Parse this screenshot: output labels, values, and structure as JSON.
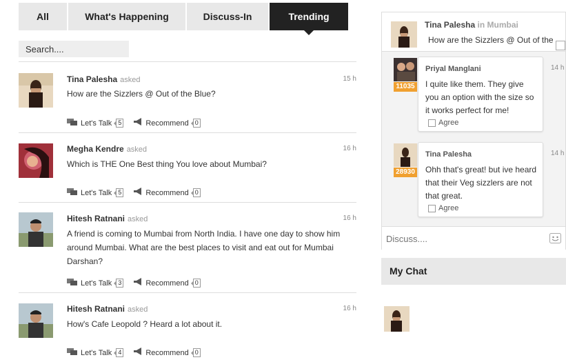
{
  "tabs": [
    {
      "label": "All",
      "active": false
    },
    {
      "label": "What's Happening",
      "active": false
    },
    {
      "label": "Discuss-In",
      "active": false
    },
    {
      "label": "Trending",
      "active": true
    }
  ],
  "search": {
    "placeholder": "Search...."
  },
  "feed": [
    {
      "name": "Tina Palesha",
      "asked": "asked",
      "time": "15 h",
      "question": "How are the Sizzlers @ Out of the Blue?",
      "talk_label": "Let's Talk",
      "talk_count": "5",
      "recommend_label": "Recommend",
      "recommend_count": "0"
    },
    {
      "name": "Megha Kendre",
      "asked": "asked",
      "time": "16 h",
      "question": "Which is THE One Best thing You love about Mumbai?",
      "talk_label": "Let's Talk",
      "talk_count": "5",
      "recommend_label": "Recommend",
      "recommend_count": "0"
    },
    {
      "name": "Hitesh Ratnani",
      "asked": "asked",
      "time": "16 h",
      "question": "A friend is coming to Mumbai from North India. I have one day to show him around Mumbai. What are the best places to visit and eat out for Mumbai Darshan?",
      "talk_label": "Let's Talk",
      "talk_count": "3",
      "recommend_label": "Recommend",
      "recommend_count": "0"
    },
    {
      "name": "Hitesh Ratnani",
      "asked": "asked",
      "time": "16 h",
      "question": "How's Cafe Leopold ? Heard a lot about it.",
      "talk_label": "Let's Talk",
      "talk_count": "4",
      "recommend_label": "Recommend",
      "recommend_count": "0"
    }
  ],
  "panel": {
    "author": "Tina Palesha",
    "location_prefix": "in",
    "location": "Mumbai",
    "question": "How are the Sizzlers @ Out of the",
    "replies": [
      {
        "name": "Priyal Manglani",
        "badge": "11035",
        "time": "14 h",
        "text": "I quite like them. They give you an option with the size so it works perfect for me!",
        "agree": "Agree"
      },
      {
        "name": "Tina Palesha",
        "badge": "28930",
        "time": "14 h",
        "text": "Ohh that's great! but ive heard that their Veg sizzlers are not that great.",
        "agree": "Agree"
      }
    ],
    "discuss_placeholder": "Discuss...."
  },
  "mychat": {
    "title": "My Chat"
  },
  "colors": {
    "accent": "#222222",
    "badge": "#f0a030",
    "tab_bg": "#e8e8e8"
  }
}
